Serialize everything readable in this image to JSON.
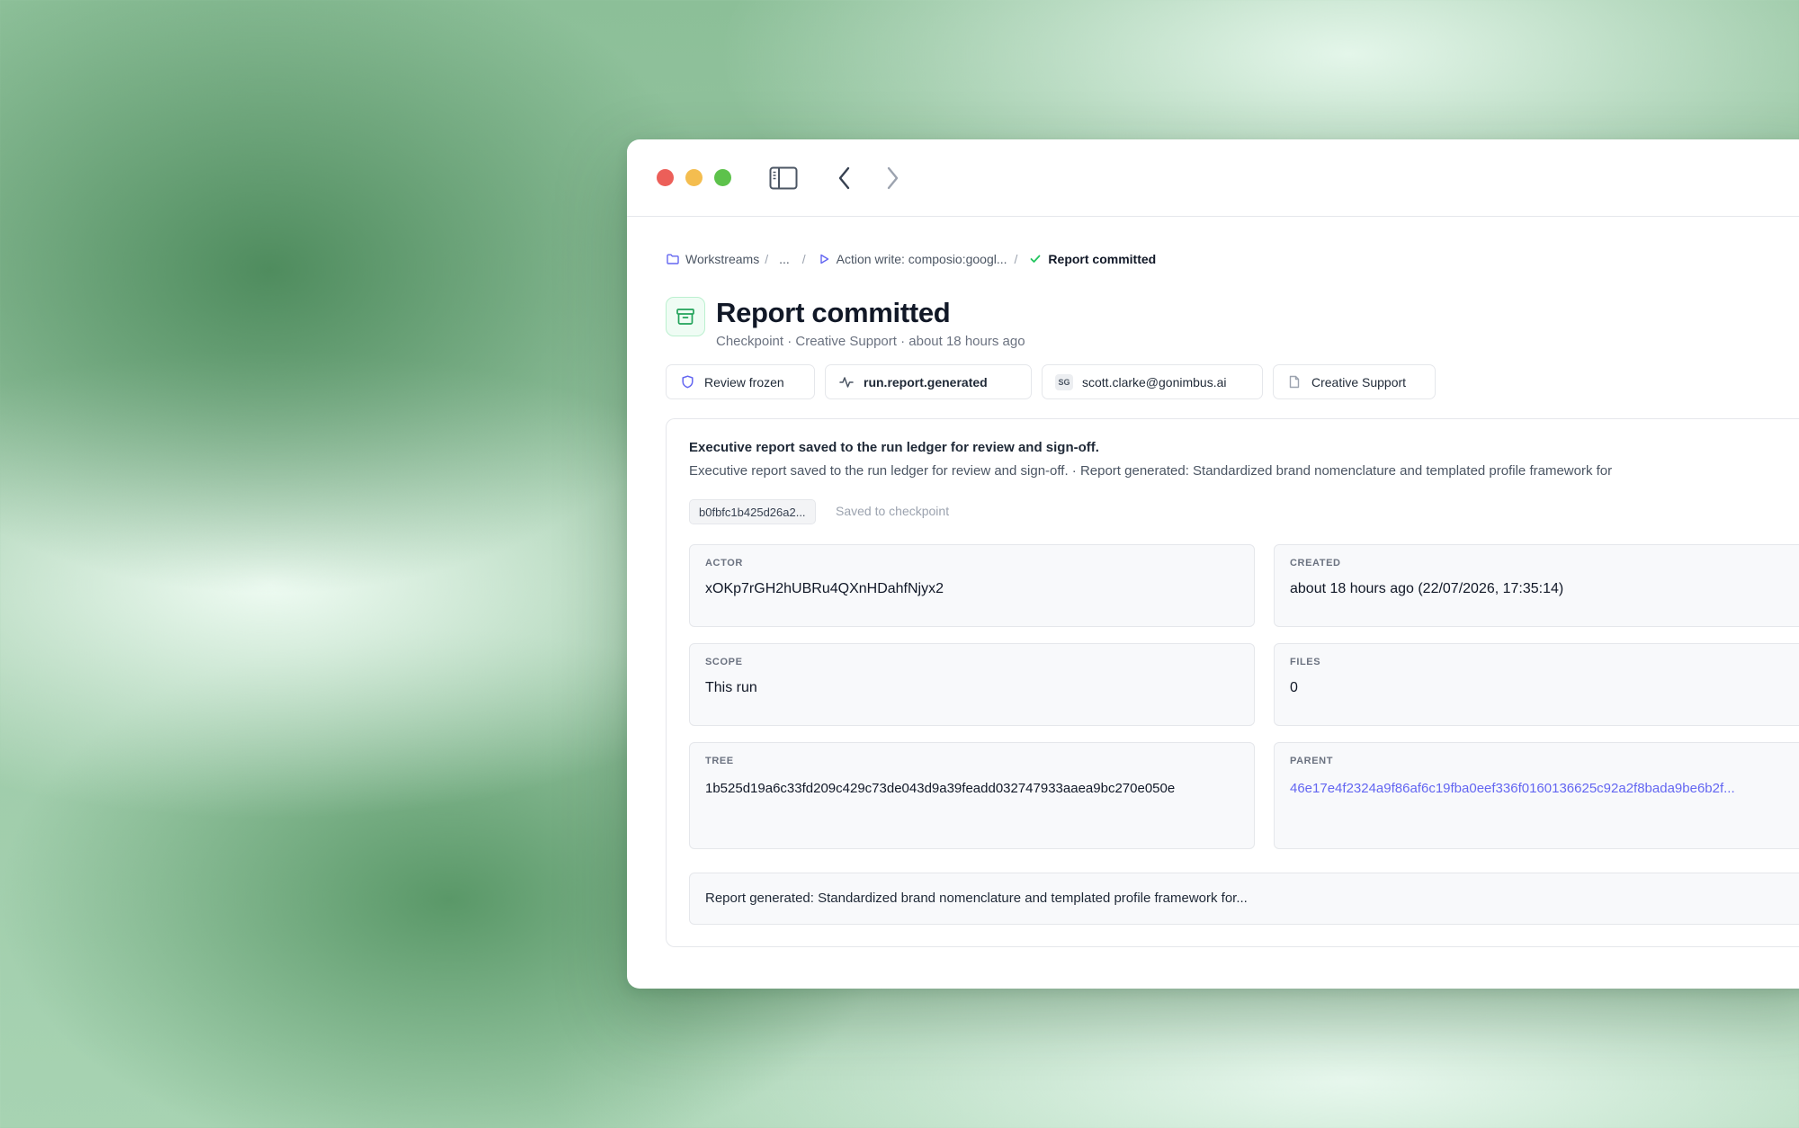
{
  "breadcrumb": {
    "root": "Workstreams",
    "ellipsis": "...",
    "action": "Action write: composio:googl...",
    "current": "Report committed"
  },
  "header": {
    "title": "Report committed",
    "subtitle": "Checkpoint · Creative Support · about 18 hours ago"
  },
  "chips": {
    "review": "Review frozen",
    "event": "run.report.generated",
    "user_initials": "SG",
    "user": "scott.clarke@gonimbus.ai",
    "project": "Creative Support"
  },
  "card": {
    "title": "Executive report saved to the run ledger for review and sign-off.",
    "description": "Executive report saved to the run ledger for review and sign-off. · Report generated: Standardized brand nomenclature and templated profile framework for",
    "hash": "b0fbfc1b425d26a2...",
    "saved_note": "Saved to checkpoint"
  },
  "fields": {
    "actor_label": "ACTOR",
    "actor": "xOKp7rGH2hUBRu4QXnHDahfNjyx2",
    "created_label": "CREATED",
    "created": "about 18 hours ago (22/07/2026, 17:35:14)",
    "scope_label": "SCOPE",
    "scope": "This run",
    "files_label": "FILES",
    "files": "0",
    "tree_label": "TREE",
    "tree": "1b525d19a6c33fd209c429c73de043d9a39feadd032747933aaea9bc270e050e",
    "parent_label": "PARENT",
    "parent": "46e17e4f2324a9f86af6c19fba0eef336f0160136625c92a2f8bada9be6b2f..."
  },
  "summary": "Report generated: Standardized brand nomenclature and templated profile framework for...",
  "colors": {
    "accent_link": "#6366f1",
    "success": "#22c55e",
    "traffic_red": "#ec5f59",
    "traffic_yellow": "#f4bd4f",
    "traffic_green": "#5dc24b"
  }
}
